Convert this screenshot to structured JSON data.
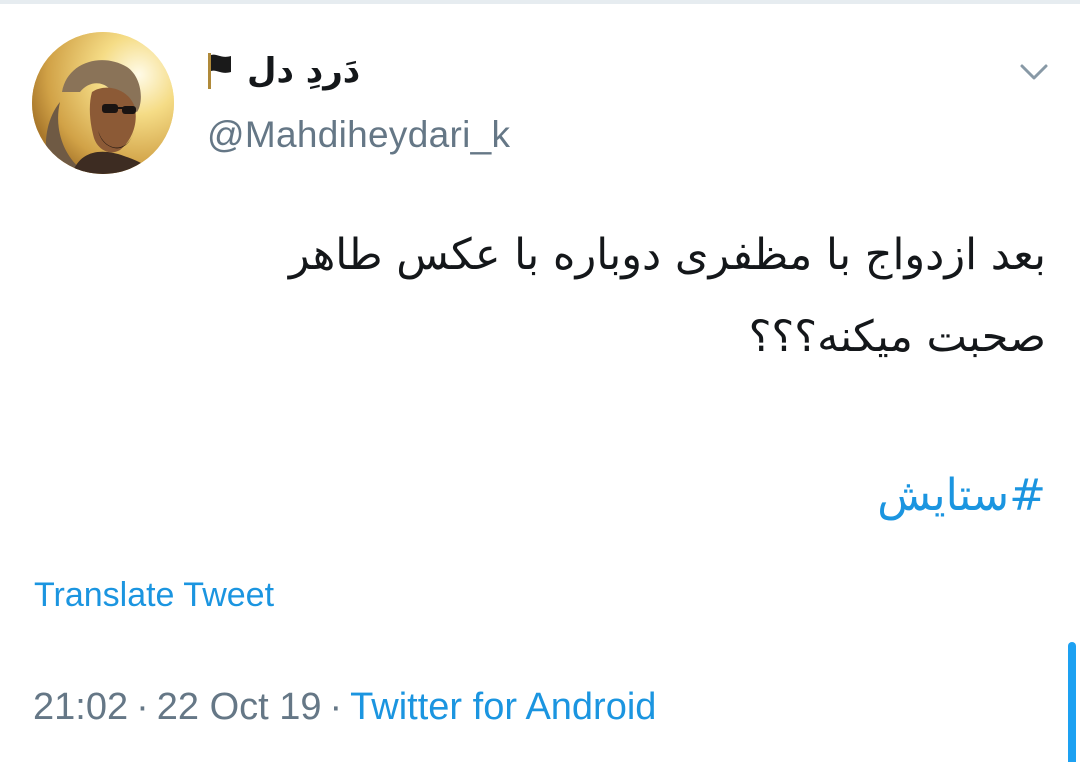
{
  "author": {
    "display_name": "دَردِ دل",
    "handle": "@Mahdiheydari_k",
    "avatar_icon": "profile-photo",
    "flag_icon": "black-flag-icon"
  },
  "tweet": {
    "text_lines": [
      "بعد ازدواج با مظفری دوباره با عکس طاهر",
      "صحبت میکنه؟؟؟"
    ],
    "hashtag": "#ستایش",
    "translate_label": "Translate Tweet"
  },
  "meta": {
    "time": "21:02",
    "separator": "·",
    "date": "22 Oct 19",
    "source": "Twitter for Android"
  },
  "menu": {
    "icon": "chevron-down-icon"
  },
  "colors": {
    "link": "#1b95e0",
    "secondary": "#657786",
    "primary_text": "#14171a",
    "scrollbar": "#1da1f2"
  }
}
